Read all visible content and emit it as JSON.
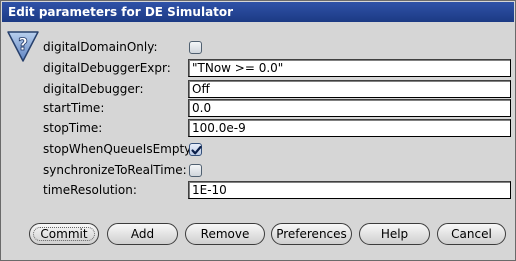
{
  "window": {
    "title": "Edit parameters for DE Simulator"
  },
  "params": [
    {
      "name": "digitalDomainOnly:",
      "type": "checkbox",
      "checked": false
    },
    {
      "name": "digitalDebuggerExpr:",
      "type": "text",
      "value": "\"TNow >= 0.0\""
    },
    {
      "name": "digitalDebugger:",
      "type": "text",
      "value": "Off"
    },
    {
      "name": "startTime:",
      "type": "text",
      "value": "0.0"
    },
    {
      "name": "stopTime:",
      "type": "text",
      "value": "100.0e-9"
    },
    {
      "name": "stopWhenQueueIsEmpty:",
      "type": "checkbox",
      "checked": true
    },
    {
      "name": "synchronizeToRealTime:",
      "type": "checkbox",
      "checked": false
    },
    {
      "name": "timeResolution:",
      "type": "text",
      "value": "1E-10"
    }
  ],
  "buttons": [
    "Commit",
    "Add",
    "Remove",
    "Preferences",
    "Help",
    "Cancel"
  ],
  "icons": {
    "help": "question-mark-icon"
  }
}
